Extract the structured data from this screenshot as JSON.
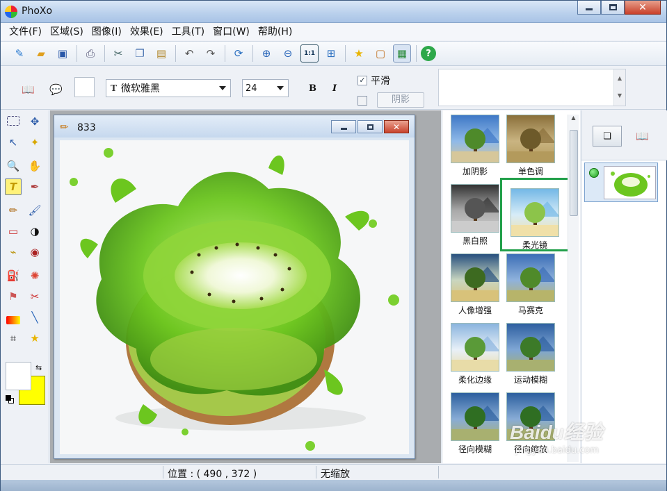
{
  "window": {
    "title": "PhoXo"
  },
  "menu": [
    "文件(F)",
    "区域(S)",
    "图像(I)",
    "效果(E)",
    "工具(T)",
    "窗口(W)",
    "帮助(H)"
  ],
  "toolbar_icons": [
    "new-icon",
    "open-icon",
    "save-icon",
    "scanner-icon",
    "cut-icon",
    "copy-icon",
    "paste-icon",
    "undo-icon",
    "redo-icon",
    "refresh-icon",
    "zoom-in-icon",
    "zoom-out-icon",
    "actual-size-icon",
    "fit-window-icon",
    "star-icon",
    "frame-icon",
    "screen-capture-icon",
    "help-icon"
  ],
  "text_options": {
    "font": "微软雅黑",
    "size": "24",
    "bold_label": "B",
    "italic_label": "I",
    "smooth_label": "平滑",
    "smooth_checked": true,
    "shadow_label": "阴影",
    "shadow_checked": false,
    "font_icon_label": "T"
  },
  "document": {
    "title": "833"
  },
  "effects": [
    {
      "label": "加阴影",
      "selected": false
    },
    {
      "label": "单色调",
      "selected": false
    },
    {
      "label": "黑白照",
      "selected": false
    },
    {
      "label": "柔光镜",
      "selected": true
    },
    {
      "label": "人像增强",
      "selected": false
    },
    {
      "label": "马赛克",
      "selected": false
    },
    {
      "label": "柔化边缘",
      "selected": false
    },
    {
      "label": "运动模糊",
      "selected": false
    },
    {
      "label": "径向模糊",
      "selected": false
    },
    {
      "label": "径向缩放",
      "selected": false
    }
  ],
  "colors": {
    "foreground": "#ffffff",
    "background": "#ffff00",
    "selection_border": "#22a04a",
    "kiwi_green": "#6cc61f"
  },
  "status": {
    "position": "位置 : ( 490 , 372 )",
    "zoom": "无缩放"
  },
  "watermark": {
    "text": "Baidu经验",
    "sub": "jingyan.baidu.com"
  }
}
